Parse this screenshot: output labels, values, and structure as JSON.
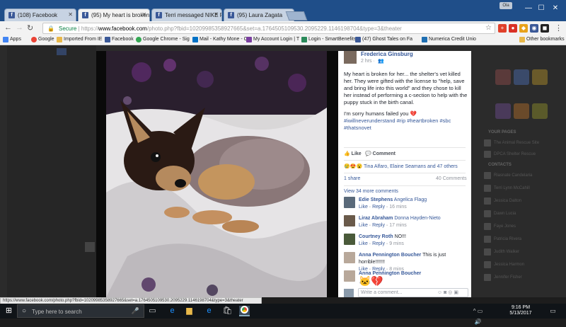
{
  "browser": {
    "tabs": [
      {
        "label": "(108) Facebook",
        "active": false
      },
      {
        "label": "(95) My heart is broken f",
        "active": true
      },
      {
        "label": "Terri messaged NIKE Ple",
        "active": false
      },
      {
        "label": "(95) Laura Zagata",
        "active": false
      }
    ],
    "window_controls": {
      "minimize": "—",
      "maximize": "☐",
      "close": "✕"
    },
    "user_badge": "Ola",
    "address": {
      "secure_label": "Secure",
      "url_scheme": "https://",
      "url_host": "www.facebook.com",
      "url_path": "/photo.php?fbid=10209985358927665&set=a.1764505109530.2095229.1146198704&type=3&theater"
    },
    "bookmarks": [
      {
        "label": "Apps"
      },
      {
        "label": "Google"
      },
      {
        "label": "Imported From IE"
      },
      {
        "label": "Facebook"
      },
      {
        "label": "Google Chrome - Sig"
      },
      {
        "label": "Mail - Kathy Mone - C"
      },
      {
        "label": "My Account Login | T"
      },
      {
        "label": "Login - SmartBenefits"
      },
      {
        "label": "(47) Ghost Tales on Fa"
      },
      {
        "label": "Numerica Credit Unio"
      }
    ],
    "other_bookmarks": "Other bookmarks"
  },
  "post": {
    "author": "Frederica Ginsburg",
    "time": "2 hrs ·",
    "body": "My heart is broken for her... the shelter's vet killed her. They were gifted with the license to \"help, save and bring life into this world\" and they chose to kill her instead of performing a c-section to help with the puppy stuck in the birth canal.",
    "sorry": "I'm sorry humans failed you",
    "hashtags": "#iwillneverunderstand #rip #heartbroken #sbc #thatsnovet",
    "like_label": "Like",
    "comment_label": "Comment",
    "reactions_text": "Tina Alfaro, Elaine Seamans and 47 others",
    "shares": "1 share",
    "comments_count": "40 Comments",
    "view_more": "View 34 more comments",
    "write_placeholder": "Write a comment..."
  },
  "comments": [
    {
      "name": "Edie Stephens",
      "text": "Angelica Flagg",
      "like": "Like",
      "reply": "Reply",
      "time": "16 mins"
    },
    {
      "name": "Liraz Abraham",
      "text": "Donna Hayden-Nieto",
      "like": "Like",
      "reply": "Reply",
      "time": "17 mins"
    },
    {
      "name": "Courtney Roth",
      "text": "NO!!!",
      "like": "Like",
      "reply": "Reply",
      "time": "9 mins"
    },
    {
      "name": "Anna Pennington Boucher",
      "text": "This is just horrible!!!!!!!",
      "like": "Like",
      "reply": "Reply",
      "time": "8 mins"
    },
    {
      "name": "Anna Pennington Boucher",
      "text": "",
      "like": "",
      "reply": "",
      "time": ""
    }
  ],
  "sidebar": {
    "your_pages": "YOUR PAGES",
    "contacts": "CONTACTS",
    "pages": [
      "The Animal Rescue Site",
      "DPCA Shelter Rescue"
    ],
    "contacts_list": [
      "Riasnate Candelaria",
      "Terri Lynn McCahill",
      "Jessica Dalton",
      "Dawn Lucia",
      "Faye Jones",
      "Patricia Rivera",
      "Judith Walker",
      "Jessica Harmon",
      "Jennifer Fisher"
    ]
  },
  "status_url": "https://www.facebook.com/photo.php?fbid=10209985358927665&set=a.1764505109530.2095229.1146198704&type=3&theater",
  "taskbar": {
    "search_placeholder": "Type here to search",
    "time": "9:16 PM",
    "date": "5/13/2017"
  },
  "colors": {
    "facebook_blue": "#3b5998",
    "link": "#365899",
    "tab_strip": "#1f4e89",
    "taskbar": "#101418"
  }
}
